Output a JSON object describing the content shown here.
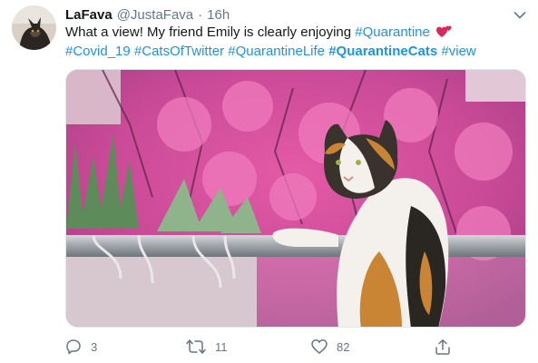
{
  "tweet": {
    "display_name": "LaFava",
    "handle": "@JustaFava",
    "separator": "·",
    "time": "16h",
    "text_intro": "What a view! My friend Emily is clearly enjoying",
    "hashtags_line1": [
      "#Quarantine"
    ],
    "hashtags_line2": [
      "#Covid_19",
      "#CatsOfTwitter",
      "#QuarantineLife",
      "#QuarantineCats",
      "#view"
    ],
    "bold_hashtag": "#QuarantineCats",
    "emoji": "two-hearts-icon",
    "media_description_icon": "cat-on-balcony-photo"
  },
  "actions": {
    "reply_count": "3",
    "retweet_count": "11",
    "like_count": "82"
  },
  "colors": {
    "link": "#1b95e0",
    "secondary_text": "#657786",
    "primary_text": "#14171a",
    "heart_emoji": "#e0245e"
  }
}
